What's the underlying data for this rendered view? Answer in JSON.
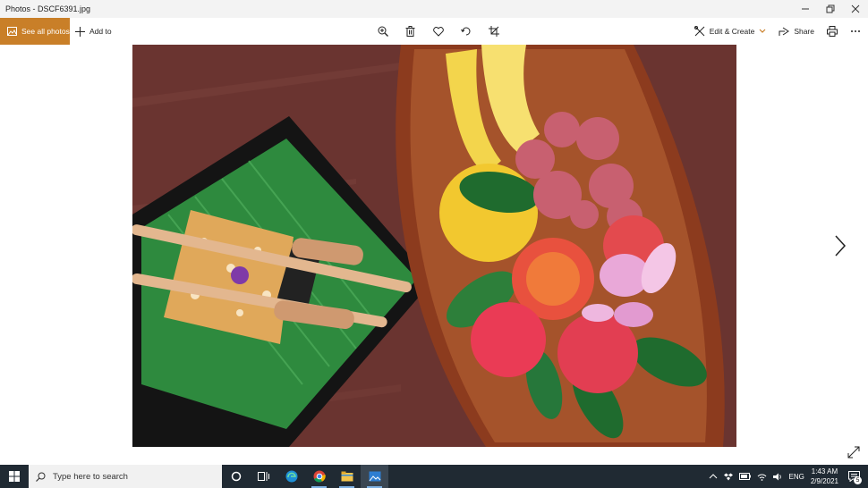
{
  "window": {
    "title": "Photos - DSCF6391.jpg"
  },
  "toolbar": {
    "see_all_label": "See all photos",
    "add_to_label": "Add to",
    "edit_create_label": "Edit & Create",
    "share_label": "Share"
  },
  "taskbar": {
    "search_placeholder": "Type here to search",
    "language": "ENG",
    "time": "1:43 AM",
    "date": "2/9/2021",
    "notification_count": "5"
  },
  "colors": {
    "accent": "#c97f28",
    "taskbar": "#202a33"
  }
}
